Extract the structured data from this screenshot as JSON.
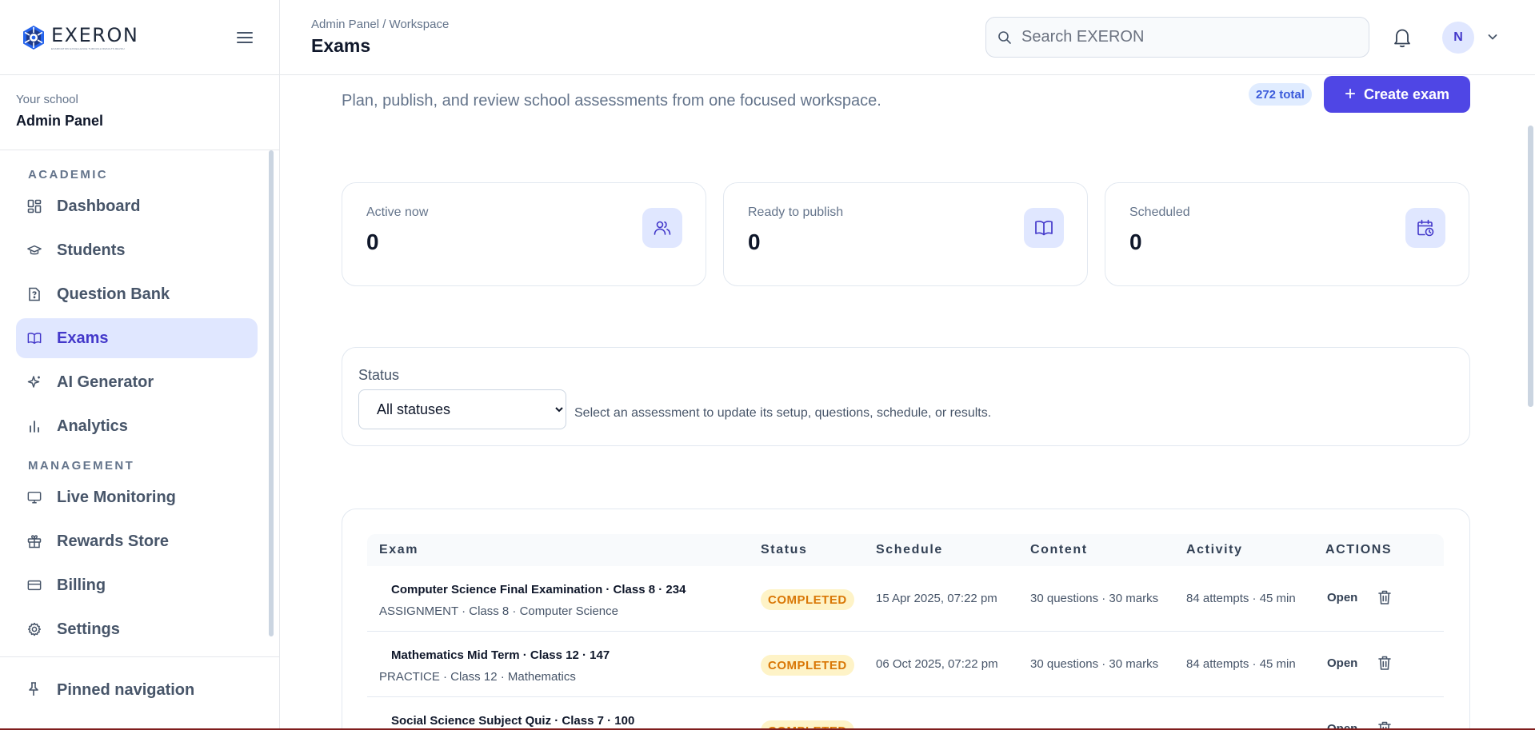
{
  "brand": {
    "name": "EXERON",
    "tagline": "EXAMINATION EXCELLENCE THROUGH RESULTS REVOLUTION"
  },
  "school": {
    "caption": "Your school",
    "name": "Admin Panel"
  },
  "sidebar": {
    "sections": [
      {
        "heading": "ACADEMIC",
        "items": [
          {
            "label": "Dashboard",
            "icon": "dashboard-icon"
          },
          {
            "label": "Students",
            "icon": "graduation-cap-icon"
          },
          {
            "label": "Question Bank",
            "icon": "question-file-icon"
          },
          {
            "label": "Exams",
            "icon": "book-open-icon",
            "active": true
          },
          {
            "label": "AI Generator",
            "icon": "sparkles-icon"
          },
          {
            "label": "Analytics",
            "icon": "bar-chart-icon"
          }
        ]
      },
      {
        "heading": "MANAGEMENT",
        "items": [
          {
            "label": "Live Monitoring",
            "icon": "monitor-icon"
          },
          {
            "label": "Rewards Store",
            "icon": "gift-icon"
          },
          {
            "label": "Billing",
            "icon": "credit-card-icon"
          },
          {
            "label": "Settings",
            "icon": "gear-icon"
          }
        ]
      }
    ],
    "pinned_label": "Pinned navigation"
  },
  "header": {
    "breadcrumb": "Admin Panel / Workspace",
    "title": "Exams",
    "search_placeholder": "Search EXERON",
    "avatar_initial": "N"
  },
  "main": {
    "subtitle": "Plan, publish, and review school assessments from one focused workspace.",
    "total_badge": "272 total",
    "create_label": "Create exam",
    "stats": [
      {
        "caption": "Active now",
        "value": "0",
        "icon": "users-icon"
      },
      {
        "caption": "Ready to publish",
        "value": "0",
        "icon": "book-open-icon"
      },
      {
        "caption": "Scheduled",
        "value": "0",
        "icon": "calendar-clock-icon"
      }
    ],
    "filter": {
      "label": "Status",
      "selected": "All statuses",
      "hint": "Select an assessment to update its setup, questions, schedule, or results."
    },
    "table": {
      "columns": [
        "Exam",
        "Status",
        "Schedule",
        "Content",
        "Activity",
        "ACTIONS"
      ],
      "rows": [
        {
          "title": "Computer Science Final Examination · Class 8 · 234",
          "meta": "ASSIGNMENT · Class 8 · Computer Science",
          "status": "COMPLETED",
          "schedule": "15 Apr 2025, 07:22 pm",
          "content": "30 questions · 30 marks",
          "activity": "84 attempts · 45 min",
          "action": "Open"
        },
        {
          "title": "Mathematics Mid Term · Class 12 · 147",
          "meta": "PRACTICE · Class 12 · Mathematics",
          "status": "COMPLETED",
          "schedule": "06 Oct 2025, 07:22 pm",
          "content": "30 questions · 30 marks",
          "activity": "84 attempts · 45 min",
          "action": "Open"
        },
        {
          "title": "Social Science Subject Quiz · Class 7 · 100",
          "meta": "",
          "status": "COMPLETED",
          "schedule": "",
          "content": "",
          "activity": "",
          "action": "Open"
        }
      ]
    }
  },
  "colors": {
    "accent": "#4f46e5",
    "active_nav_bg": "#e0e7ff",
    "status_completed_bg": "#fef3c7",
    "status_completed_text": "#d97706"
  }
}
